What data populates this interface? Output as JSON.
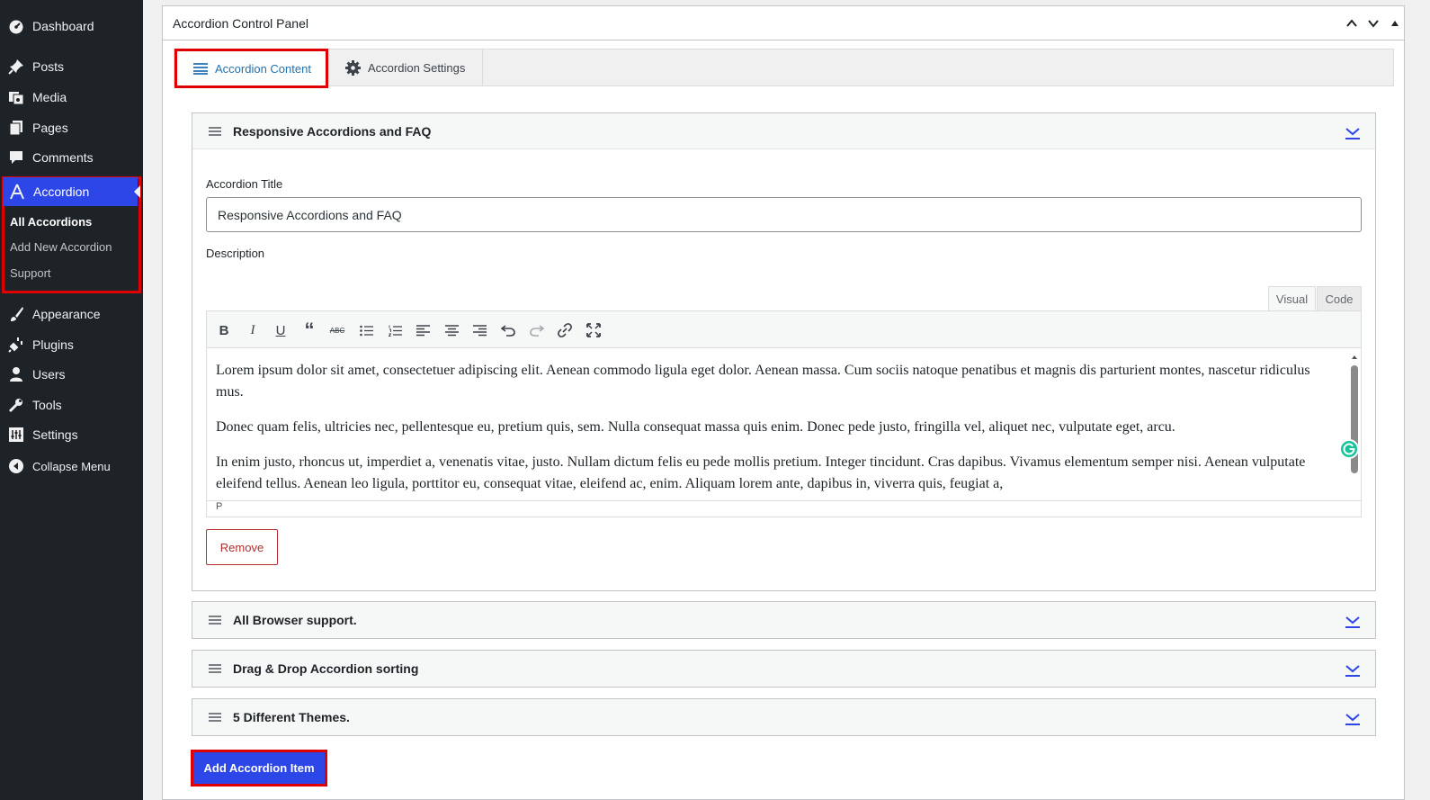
{
  "sidebar": {
    "items": [
      {
        "label": "Dashboard",
        "icon": "dashboard-icon"
      },
      {
        "label": "Posts",
        "icon": "pushpin-icon"
      },
      {
        "label": "Media",
        "icon": "media-icon"
      },
      {
        "label": "Pages",
        "icon": "pages-icon"
      },
      {
        "label": "Comments",
        "icon": "comment-icon"
      },
      {
        "label": "Accordion",
        "icon": "accordion-icon"
      },
      {
        "label": "Appearance",
        "icon": "paintbrush-icon"
      },
      {
        "label": "Plugins",
        "icon": "plugin-icon"
      },
      {
        "label": "Users",
        "icon": "users-icon"
      },
      {
        "label": "Tools",
        "icon": "wrench-icon"
      },
      {
        "label": "Settings",
        "icon": "settings-icon"
      },
      {
        "label": "Collapse Menu",
        "icon": "collapse-icon"
      }
    ],
    "submenu": [
      "All Accordions",
      "Add New Accordion",
      "Support"
    ]
  },
  "panel": {
    "title": "Accordion Control Panel",
    "tabs": [
      "Accordion Content",
      "Accordion Settings"
    ]
  },
  "item1": {
    "header": "Responsive Accordions and FAQ",
    "title_label": "Accordion Title",
    "title_value": "Responsive Accordions and FAQ",
    "desc_label": "Description",
    "editor_tabs": [
      "Visual",
      "Code"
    ],
    "paragraphs": [
      "Lorem ipsum dolor sit amet, consectetuer adipiscing elit. Aenean commodo ligula eget dolor. Aenean massa. Cum sociis natoque penatibus et magnis dis parturient montes, nascetur ridiculus mus.",
      "Donec quam felis, ultricies nec, pellentesque eu, pretium quis, sem. Nulla consequat massa quis enim. Donec pede justo, fringilla vel, aliquet nec, vulputate eget, arcu.",
      "In enim justo, rhoncus ut, imperdiet a, venenatis vitae, justo. Nullam dictum felis eu pede mollis pretium. Integer tincidunt. Cras dapibus. Vivamus elementum semper nisi. Aenean vulputate eleifend tellus. Aenean leo ligula, porttitor eu, consequat vitae, eleifend ac, enim. Aliquam lorem ante, dapibus in, viverra quis, feugiat a,"
    ],
    "status_path": "P",
    "remove_label": "Remove"
  },
  "other_items": [
    "All Browser support.",
    "Drag & Drop Accordion sorting",
    "5 Different Themes."
  ],
  "add_label": "Add Accordion Item",
  "colors": {
    "accent": "#2c46e8",
    "highlight": "#e00000",
    "danger": "#b32d2e"
  }
}
